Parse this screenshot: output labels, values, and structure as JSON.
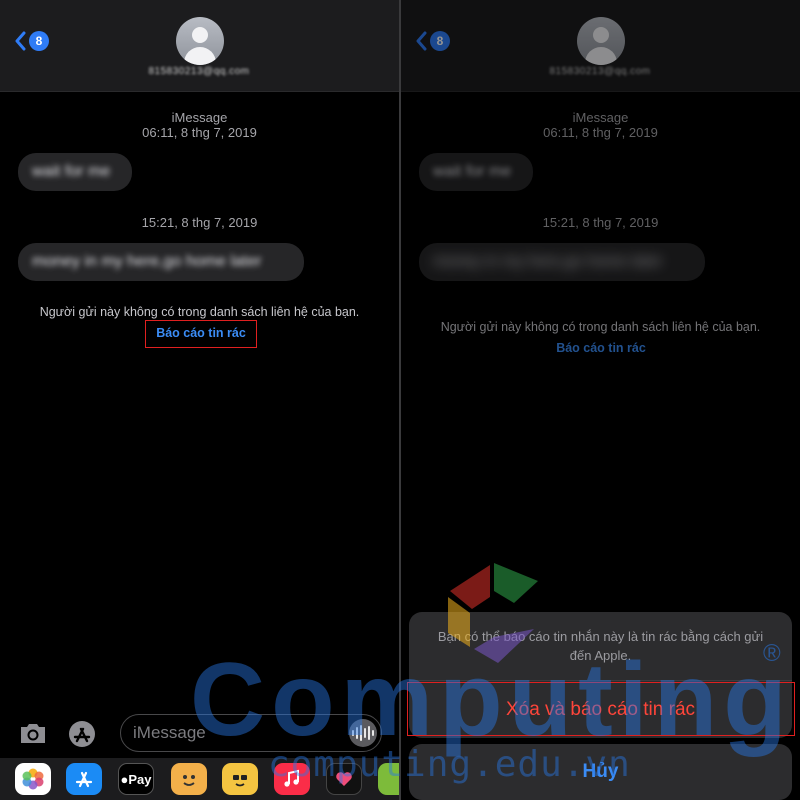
{
  "left": {
    "header": {
      "badge_count": "8",
      "contact": "815830213@qq.com"
    },
    "messages": [
      {
        "timestamp_service": "iMessage",
        "timestamp": "06:11, 8 thg 7, 2019",
        "text": "wait for me"
      },
      {
        "timestamp": "15:21, 8 thg 7, 2019",
        "text": "money in my here,go home later"
      }
    ],
    "notice": "Người gửi này không có trong danh sách liên hệ của bạn.",
    "report_link": "Báo cáo tin rác",
    "input_placeholder": "iMessage",
    "apps": [
      {
        "name": "photos-app-icon",
        "label": "",
        "bg": "#ffffff"
      },
      {
        "name": "app-store-app-icon",
        "label": "",
        "bg": "#1b8bf5"
      },
      {
        "name": "apple-pay-app-icon",
        "label": "Pay",
        "bg": "#000000"
      },
      {
        "name": "memoji-app-icon",
        "label": "",
        "bg": "#f3b04a"
      },
      {
        "name": "memoji-stickers-app-icon",
        "label": "",
        "bg": "#f4c441"
      },
      {
        "name": "music-app-icon",
        "label": "",
        "bg": "#fa2d48"
      },
      {
        "name": "digital-touch-app-icon",
        "label": "",
        "bg": "#111111"
      },
      {
        "name": "extra-app-icon",
        "label": "",
        "bg": "#7dbb3a"
      }
    ]
  },
  "right": {
    "header": {
      "badge_count": "8",
      "contact": "815830213@qq.com"
    },
    "messages": [
      {
        "timestamp_service": "iMessage",
        "timestamp": "06:11, 8 thg 7, 2019",
        "text": "wait for me"
      },
      {
        "timestamp": "15:21, 8 thg 7, 2019",
        "text": "money in my here,go home later"
      }
    ],
    "notice": "Người gửi này không có trong danh sách liên hệ của bạn.",
    "report_link": "Báo cáo tin rác",
    "action_sheet": {
      "message": "Bạn có thể báo cáo tin nhắn này là tin rác bằng cách gửi đến Apple.",
      "destructive_label": "Xóa và báo cáo tin rác",
      "cancel_label": "Hủy"
    }
  },
  "watermark": {
    "brand": "Computing",
    "domain": "computing.edu.vn",
    "registered": "®"
  },
  "colors": {
    "accent": "#3b8cf5",
    "destructive": "#ff453a",
    "badge": "#2f7cf6",
    "highlight_box": "#e02020"
  }
}
